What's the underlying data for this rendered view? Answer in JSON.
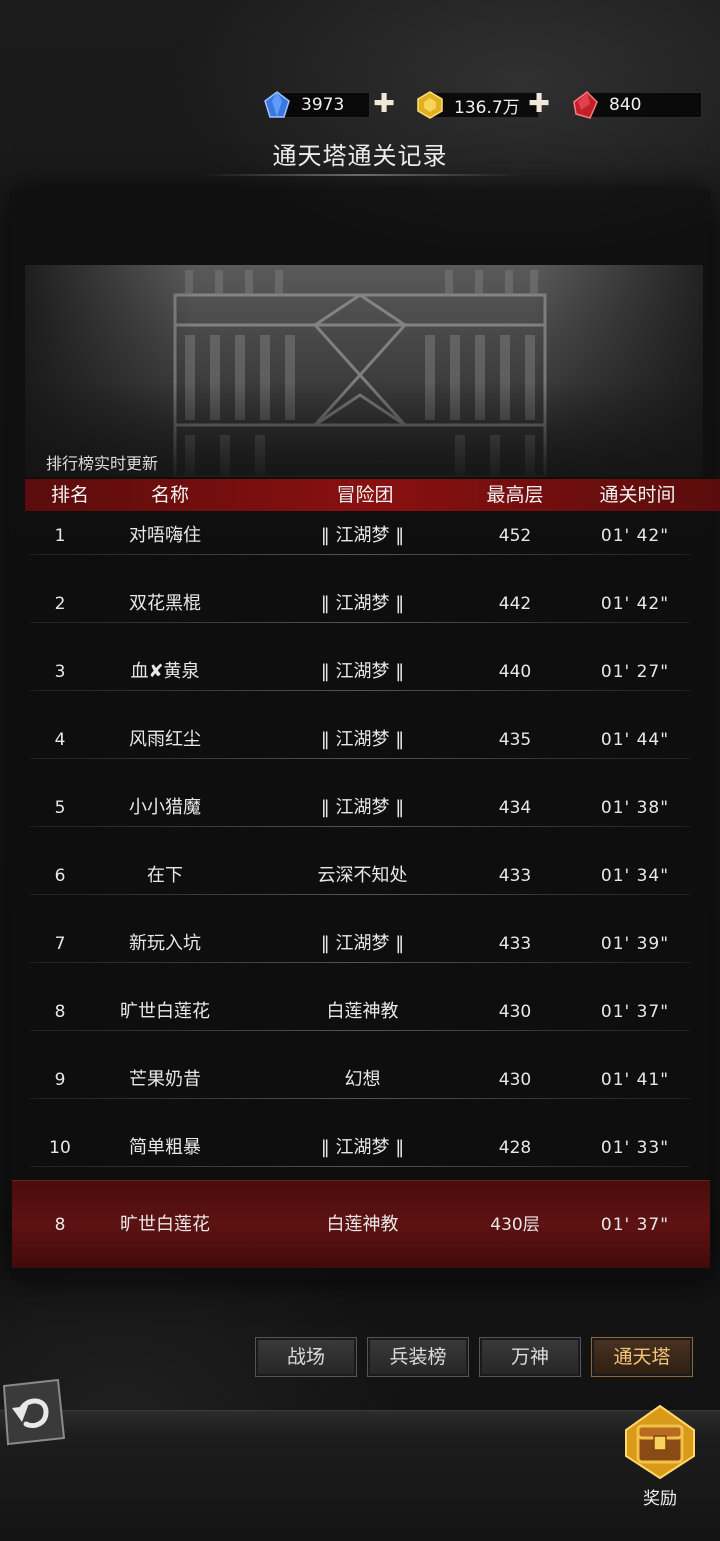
{
  "currency": {
    "diamond": {
      "value": "3973",
      "icon": "blue-diamond-icon"
    },
    "gold": {
      "value": "136.7万",
      "icon": "gold-gem-icon"
    },
    "ruby": {
      "value": "840",
      "icon": "red-crystal-icon"
    }
  },
  "title": "通天塔通关记录",
  "realtime_label": "排行榜实时更新",
  "table": {
    "headers": [
      "排名",
      "名称",
      "冒险团",
      "最高层",
      "通关时间"
    ],
    "rows": [
      {
        "rank": "1",
        "name": "对唔嗨住",
        "guild": "‖ 江湖梦 ‖",
        "floor": "452",
        "time": "01' 42\""
      },
      {
        "rank": "2",
        "name": "双花黑棍",
        "guild": "‖ 江湖梦 ‖",
        "floor": "442",
        "time": "01' 42\""
      },
      {
        "rank": "3",
        "name": "血✘黄泉",
        "guild": "‖ 江湖梦 ‖",
        "floor": "440",
        "time": "01' 27\""
      },
      {
        "rank": "4",
        "name": "风雨红尘",
        "guild": "‖ 江湖梦 ‖",
        "floor": "435",
        "time": "01' 44\""
      },
      {
        "rank": "5",
        "name": "小小猎魔",
        "guild": "‖ 江湖梦 ‖",
        "floor": "434",
        "time": "01' 38\""
      },
      {
        "rank": "6",
        "name": "在下",
        "guild": "云深不知处",
        "floor": "433",
        "time": "01' 34\""
      },
      {
        "rank": "7",
        "name": "新玩入坑",
        "guild": "‖ 江湖梦 ‖",
        "floor": "433",
        "time": "01' 39\""
      },
      {
        "rank": "8",
        "name": "旷世白莲花",
        "guild": "白莲神教",
        "floor": "430",
        "time": "01' 37\""
      },
      {
        "rank": "9",
        "name": "芒果奶昔",
        "guild": "幻想",
        "floor": "430",
        "time": "01' 41\""
      },
      {
        "rank": "10",
        "name": "简单粗暴",
        "guild": "‖ 江湖梦 ‖",
        "floor": "428",
        "time": "01' 33\""
      }
    ]
  },
  "my_rank": {
    "rank": "8",
    "name": "旷世白莲花",
    "guild": "白莲神教",
    "floor": "430层",
    "time": "01' 37\""
  },
  "tabs": [
    {
      "label": "战场",
      "active": false
    },
    {
      "label": "兵装榜",
      "active": false
    },
    {
      "label": "万神",
      "active": false
    },
    {
      "label": "通天塔",
      "active": true
    }
  ],
  "reward_label": "奖励",
  "colors": {
    "header_red": "#8a1010",
    "my_row_red": "#5e1212",
    "active_tab_text": "#f2c67a"
  }
}
